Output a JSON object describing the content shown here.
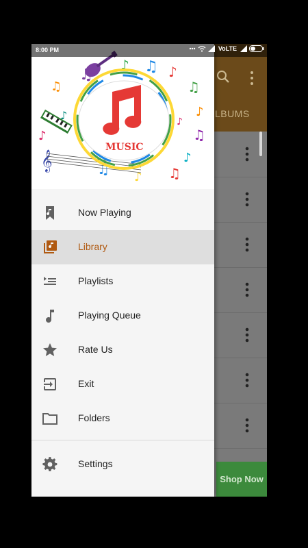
{
  "status_bar": {
    "time": "8:00 PM",
    "network": "VoLTE"
  },
  "background": {
    "tab_label": "LBUMS",
    "shop_label": "Shop Now"
  },
  "header": {
    "logo_text": "MUSIC"
  },
  "menu": {
    "items": [
      {
        "label": "Now Playing",
        "icon": "now-playing-icon"
      },
      {
        "label": "Library",
        "icon": "library-icon",
        "active": true
      },
      {
        "label": "Playlists",
        "icon": "playlist-icon"
      },
      {
        "label": "Playing Queue",
        "icon": "music-note-icon"
      },
      {
        "label": "Rate Us",
        "icon": "star-icon"
      },
      {
        "label": "Exit",
        "icon": "exit-icon"
      },
      {
        "label": "Folders",
        "icon": "folder-icon"
      }
    ],
    "settings": {
      "label": "Settings",
      "icon": "gear-icon"
    }
  },
  "colors": {
    "accent": "#b05a12",
    "app_bar": "#6b4a1a",
    "shop_button": "#3c8a3c"
  }
}
